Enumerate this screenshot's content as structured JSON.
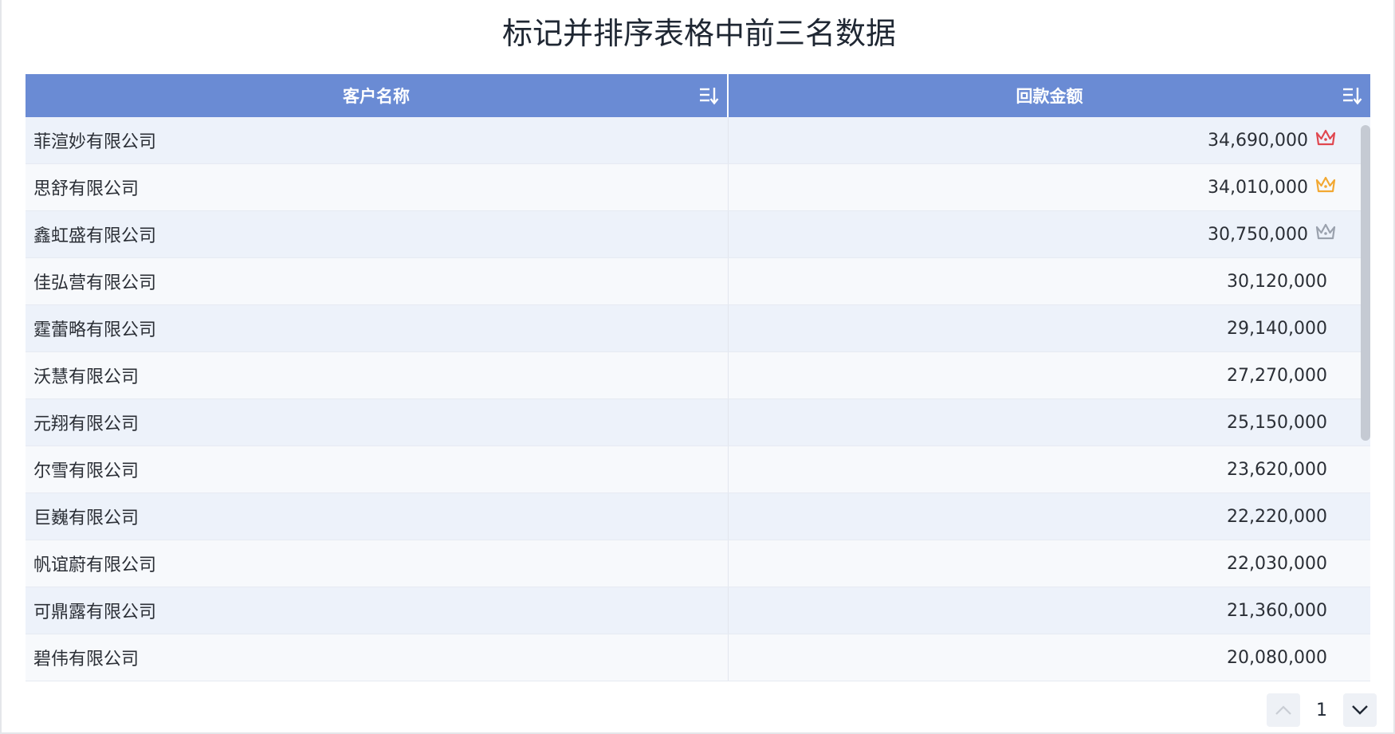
{
  "title": "标记并排序表格中前三名数据",
  "columns": [
    {
      "label": "客户名称",
      "icon": "sort-icon"
    },
    {
      "label": "回款金额",
      "icon": "sort-icon"
    }
  ],
  "rows": [
    {
      "name": "菲渲妙有限公司",
      "amount": "34,690,000",
      "rank_icon": "crown-icon",
      "rank_color": "#e0474f"
    },
    {
      "name": "思舒有限公司",
      "amount": "34,010,000",
      "rank_icon": "crown-icon",
      "rank_color": "#f2a832"
    },
    {
      "name": "鑫虹盛有限公司",
      "amount": "30,750,000",
      "rank_icon": "crown-icon",
      "rank_color": "#9aa1ad"
    },
    {
      "name": "佳弘营有限公司",
      "amount": "30,120,000"
    },
    {
      "name": "霆蕾略有限公司",
      "amount": "29,140,000"
    },
    {
      "name": "沃慧有限公司",
      "amount": "27,270,000"
    },
    {
      "name": "元翔有限公司",
      "amount": "25,150,000"
    },
    {
      "name": "尔雪有限公司",
      "amount": "23,620,000"
    },
    {
      "name": "巨巍有限公司",
      "amount": "22,220,000"
    },
    {
      "name": "帆谊蔚有限公司",
      "amount": "22,030,000"
    },
    {
      "name": "可鼎露有限公司",
      "amount": "21,360,000"
    },
    {
      "name": "碧伟有限公司",
      "amount": "20,080,000"
    },
    {
      "name": "",
      "amount": ""
    }
  ],
  "pager": {
    "page": "1",
    "prev_icon": "chevron-up-icon",
    "next_icon": "chevron-down-icon"
  },
  "colors": {
    "header_bg": "#6a8bd4",
    "row_odd": "#edf2fa",
    "row_even": "#f7f9fc"
  }
}
